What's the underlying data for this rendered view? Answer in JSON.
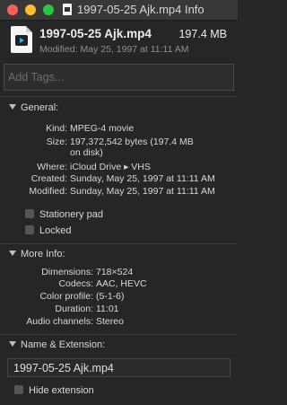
{
  "window": {
    "title": "1997-05-25 Ajk.mp4 Info"
  },
  "header": {
    "file_name": "1997-05-25 Ajk.mp4",
    "file_size": "197.4 MB",
    "modified_line": "Modified: May 25, 1997 at 11:11 AM"
  },
  "tags": {
    "placeholder": "Add Tags..."
  },
  "general": {
    "title": "General:",
    "rows": [
      {
        "key": "Kind:",
        "value": "MPEG-4 movie"
      },
      {
        "key": "Size:",
        "value": "197,372,542 bytes (197.4 MB"
      },
      {
        "key": "",
        "value": "on disk)"
      },
      {
        "key": "Where:",
        "value": "iCloud Drive ▸ VHS"
      },
      {
        "key": "Created:",
        "value": "Sunday, May 25, 1997 at 11:11 AM"
      },
      {
        "key": "Modified:",
        "value": "Sunday, May 25, 1997 at 11:11 AM"
      }
    ],
    "stationery_label": "Stationery pad",
    "locked_label": "Locked"
  },
  "more_info": {
    "title": "More Info:",
    "rows": [
      {
        "key": "Dimensions:",
        "value": "718×524"
      },
      {
        "key": "Codecs:",
        "value": "AAC, HEVC"
      },
      {
        "key": "Color profile:",
        "value": "(5-1-6)"
      },
      {
        "key": "Duration:",
        "value": "11:01"
      },
      {
        "key": "Audio channels:",
        "value": "Stereo"
      }
    ]
  },
  "name_ext": {
    "title": "Name & Extension:",
    "value": "1997-05-25 Ajk.mp4",
    "hide_extension_label": "Hide extension"
  },
  "colors": {
    "close": "#fe5f57",
    "minimize": "#febc2e",
    "zoom": "#28c840",
    "background": "#262626"
  }
}
